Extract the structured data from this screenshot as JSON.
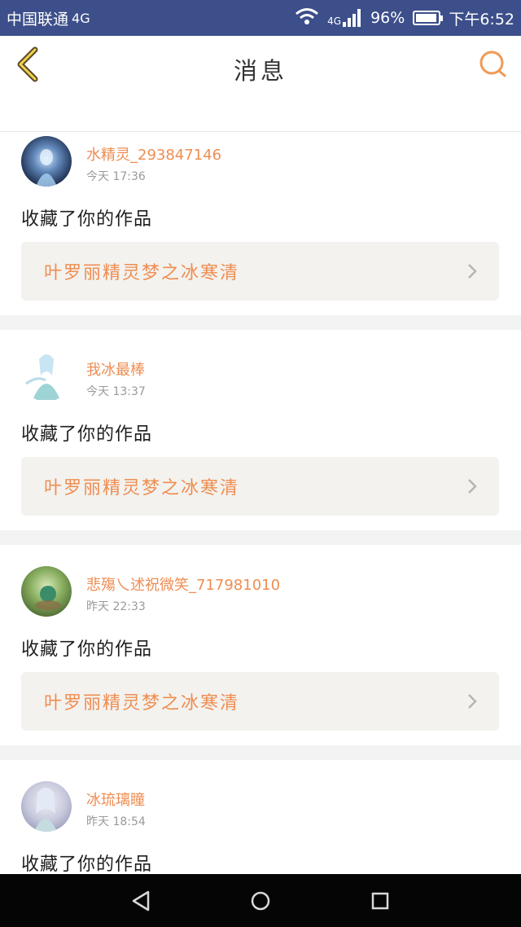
{
  "status_bar": {
    "carrier": "中国联通",
    "network": "4G",
    "signal_label": "4G",
    "battery": "96%",
    "time": "下午6:52"
  },
  "header": {
    "title": "消息",
    "back_icon": "chevron-left-icon",
    "search_icon": "search-icon"
  },
  "messages": [
    {
      "username": "水精灵_293847146",
      "time": "今天 17:36",
      "action": "收藏了你的作品",
      "work_title": "叶罗丽精灵梦之冰寒清"
    },
    {
      "username": "我冰最棒",
      "time": "今天 13:37",
      "action": "收藏了你的作品",
      "work_title": "叶罗丽精灵梦之冰寒清"
    },
    {
      "username": "悲殤乀述祝微笑_717981010",
      "time": "昨天 22:33",
      "action": "收藏了你的作品",
      "work_title": "叶罗丽精灵梦之冰寒清"
    },
    {
      "username": "冰琉璃瞳",
      "time": "昨天 18:54",
      "action": "收藏了你的作品"
    }
  ],
  "colors": {
    "accent": "#ef8d52",
    "status_bar": "#3d4f8a",
    "card_bg": "#f3f2ee",
    "separator": "#f3f3f3"
  },
  "nav_bar": {
    "back": "triangle-back-icon",
    "home": "circle-home-icon",
    "recents": "square-recents-icon"
  }
}
